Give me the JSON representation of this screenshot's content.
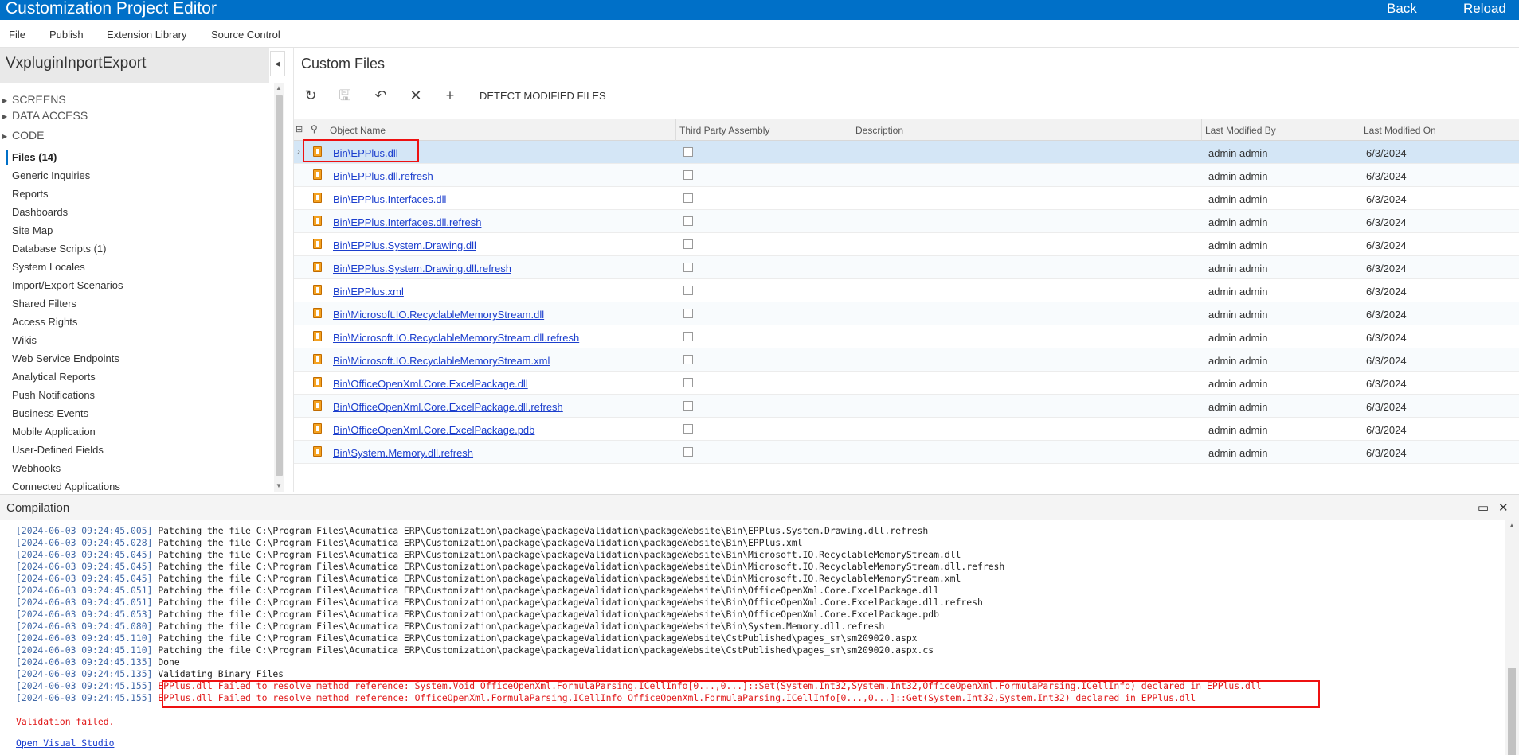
{
  "app": {
    "title": "Customization Project Editor",
    "back_label": "Back",
    "reload_label": "Reload"
  },
  "menu": {
    "items": [
      "File",
      "Publish",
      "Extension Library",
      "Source Control"
    ]
  },
  "project": {
    "name": "VxpluginInportExport"
  },
  "tree": {
    "nodes": [
      "SCREENS",
      "DATA ACCESS",
      "CODE"
    ],
    "items": [
      "Files (14)",
      "Generic Inquiries",
      "Reports",
      "Dashboards",
      "Site Map",
      "Database Scripts (1)",
      "System Locales",
      "Import/Export Scenarios",
      "Shared Filters",
      "Access Rights",
      "Wikis",
      "Web Service Endpoints",
      "Analytical Reports",
      "Push Notifications",
      "Business Events",
      "Mobile Application",
      "User-Defined Fields",
      "Webhooks",
      "Connected Applications"
    ]
  },
  "page": {
    "title": "Custom Files",
    "detect_label": "DETECT MODIFIED FILES"
  },
  "toolbar": {
    "icons": [
      "refresh-icon",
      "save-icon",
      "undo-icon",
      "delete-icon",
      "add-icon"
    ]
  },
  "grid": {
    "columns": {
      "name": "Object Name",
      "third_party": "Third Party Assembly",
      "description": "Description",
      "modified_by": "Last Modified By",
      "modified_on": "Last Modified On"
    },
    "rows": [
      {
        "name": "Bin\\EPPlus.dll",
        "third_party": false,
        "description": "",
        "modified_by": "admin admin",
        "modified_on": "6/3/2024"
      },
      {
        "name": "Bin\\EPPlus.dll.refresh",
        "third_party": false,
        "description": "",
        "modified_by": "admin admin",
        "modified_on": "6/3/2024"
      },
      {
        "name": "Bin\\EPPlus.Interfaces.dll",
        "third_party": false,
        "description": "",
        "modified_by": "admin admin",
        "modified_on": "6/3/2024"
      },
      {
        "name": "Bin\\EPPlus.Interfaces.dll.refresh",
        "third_party": false,
        "description": "",
        "modified_by": "admin admin",
        "modified_on": "6/3/2024"
      },
      {
        "name": "Bin\\EPPlus.System.Drawing.dll",
        "third_party": false,
        "description": "",
        "modified_by": "admin admin",
        "modified_on": "6/3/2024"
      },
      {
        "name": "Bin\\EPPlus.System.Drawing.dll.refresh",
        "third_party": false,
        "description": "",
        "modified_by": "admin admin",
        "modified_on": "6/3/2024"
      },
      {
        "name": "Bin\\EPPlus.xml",
        "third_party": false,
        "description": "",
        "modified_by": "admin admin",
        "modified_on": "6/3/2024"
      },
      {
        "name": "Bin\\Microsoft.IO.RecyclableMemoryStream.dll",
        "third_party": false,
        "description": "",
        "modified_by": "admin admin",
        "modified_on": "6/3/2024"
      },
      {
        "name": "Bin\\Microsoft.IO.RecyclableMemoryStream.dll.refresh",
        "third_party": false,
        "description": "",
        "modified_by": "admin admin",
        "modified_on": "6/3/2024"
      },
      {
        "name": "Bin\\Microsoft.IO.RecyclableMemoryStream.xml",
        "third_party": false,
        "description": "",
        "modified_by": "admin admin",
        "modified_on": "6/3/2024"
      },
      {
        "name": "Bin\\OfficeOpenXml.Core.ExcelPackage.dll",
        "third_party": false,
        "description": "",
        "modified_by": "admin admin",
        "modified_on": "6/3/2024"
      },
      {
        "name": "Bin\\OfficeOpenXml.Core.ExcelPackage.dll.refresh",
        "third_party": false,
        "description": "",
        "modified_by": "admin admin",
        "modified_on": "6/3/2024"
      },
      {
        "name": "Bin\\OfficeOpenXml.Core.ExcelPackage.pdb",
        "third_party": false,
        "description": "",
        "modified_by": "admin admin",
        "modified_on": "6/3/2024"
      },
      {
        "name": "Bin\\System.Memory.dll.refresh",
        "third_party": false,
        "description": "",
        "modified_by": "admin admin",
        "modified_on": "6/3/2024"
      }
    ]
  },
  "compilation": {
    "title": "Compilation",
    "log": [
      {
        "ts": "[2024-06-03 09:24:45.005]",
        "msg": "Patching the file C:\\Program Files\\Acumatica ERP\\Customization\\package\\packageValidation\\packageWebsite\\Bin\\EPPlus.System.Drawing.dll.refresh",
        "error": false
      },
      {
        "ts": "[2024-06-03 09:24:45.028]",
        "msg": "Patching the file C:\\Program Files\\Acumatica ERP\\Customization\\package\\packageValidation\\packageWebsite\\Bin\\EPPlus.xml",
        "error": false
      },
      {
        "ts": "[2024-06-03 09:24:45.045]",
        "msg": "Patching the file C:\\Program Files\\Acumatica ERP\\Customization\\package\\packageValidation\\packageWebsite\\Bin\\Microsoft.IO.RecyclableMemoryStream.dll",
        "error": false
      },
      {
        "ts": "[2024-06-03 09:24:45.045]",
        "msg": "Patching the file C:\\Program Files\\Acumatica ERP\\Customization\\package\\packageValidation\\packageWebsite\\Bin\\Microsoft.IO.RecyclableMemoryStream.dll.refresh",
        "error": false
      },
      {
        "ts": "[2024-06-03 09:24:45.045]",
        "msg": "Patching the file C:\\Program Files\\Acumatica ERP\\Customization\\package\\packageValidation\\packageWebsite\\Bin\\Microsoft.IO.RecyclableMemoryStream.xml",
        "error": false
      },
      {
        "ts": "[2024-06-03 09:24:45.051]",
        "msg": "Patching the file C:\\Program Files\\Acumatica ERP\\Customization\\package\\packageValidation\\packageWebsite\\Bin\\OfficeOpenXml.Core.ExcelPackage.dll",
        "error": false
      },
      {
        "ts": "[2024-06-03 09:24:45.051]",
        "msg": "Patching the file C:\\Program Files\\Acumatica ERP\\Customization\\package\\packageValidation\\packageWebsite\\Bin\\OfficeOpenXml.Core.ExcelPackage.dll.refresh",
        "error": false
      },
      {
        "ts": "[2024-06-03 09:24:45.053]",
        "msg": "Patching the file C:\\Program Files\\Acumatica ERP\\Customization\\package\\packageValidation\\packageWebsite\\Bin\\OfficeOpenXml.Core.ExcelPackage.pdb",
        "error": false
      },
      {
        "ts": "[2024-06-03 09:24:45.080]",
        "msg": "Patching the file C:\\Program Files\\Acumatica ERP\\Customization\\package\\packageValidation\\packageWebsite\\Bin\\System.Memory.dll.refresh",
        "error": false
      },
      {
        "ts": "[2024-06-03 09:24:45.110]",
        "msg": "Patching the file C:\\Program Files\\Acumatica ERP\\Customization\\package\\packageValidation\\packageWebsite\\CstPublished\\pages_sm\\sm209020.aspx",
        "error": false
      },
      {
        "ts": "[2024-06-03 09:24:45.110]",
        "msg": "Patching the file C:\\Program Files\\Acumatica ERP\\Customization\\package\\packageValidation\\packageWebsite\\CstPublished\\pages_sm\\sm209020.aspx.cs",
        "error": false
      },
      {
        "ts": "[2024-06-03 09:24:45.135]",
        "msg": "Done",
        "error": false
      },
      {
        "ts": "[2024-06-03 09:24:45.135]",
        "msg": "Validating Binary Files",
        "error": false
      },
      {
        "ts": "[2024-06-03 09:24:45.155]",
        "msg": "EPPlus.dll Failed to resolve method reference: System.Void OfficeOpenXml.FormulaParsing.ICellInfo[0...,0...]::Set(System.Int32,System.Int32,OfficeOpenXml.FormulaParsing.ICellInfo) declared in EPPlus.dll",
        "error": true
      },
      {
        "ts": "[2024-06-03 09:24:45.155]",
        "msg": "EPPlus.dll Failed to resolve method reference: OfficeOpenXml.FormulaParsing.ICellInfo OfficeOpenXml.FormulaParsing.ICellInfo[0...,0...]::Get(System.Int32,System.Int32) declared in EPPlus.dll",
        "error": true
      }
    ],
    "status": "Validation failed.",
    "open_vs_label": "Open Visual Studio"
  },
  "colors": {
    "accent": "#0070c8",
    "link": "#1b3ecd",
    "error": "#e01818",
    "selected_row": "#d4e6f6"
  }
}
